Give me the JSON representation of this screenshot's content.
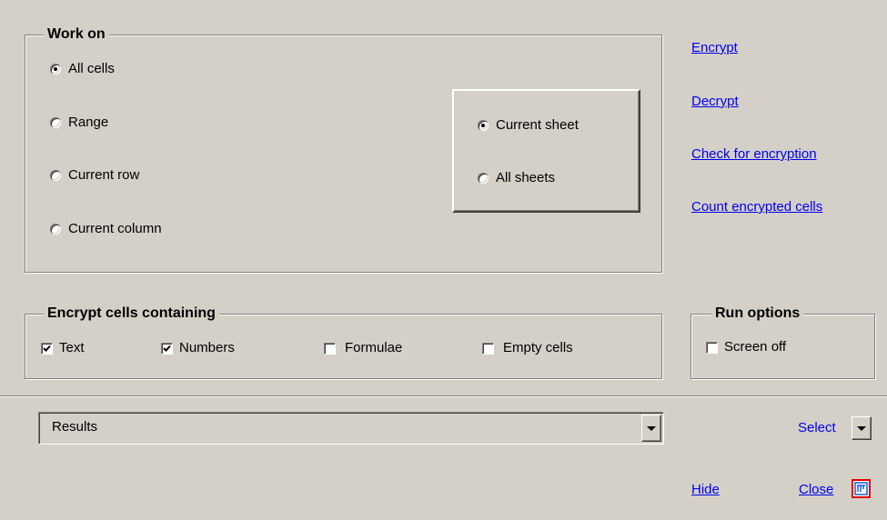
{
  "work_on": {
    "title": "Work on",
    "options": [
      "All cells",
      "Range",
      "Current row",
      "Current column"
    ],
    "selected": "All cells"
  },
  "sheet_scope": {
    "options": [
      "Current sheet",
      "All sheets"
    ],
    "selected": "Current sheet"
  },
  "actions": {
    "encrypt": "Encrypt",
    "decrypt": "Decrypt",
    "check": "Check for encryption",
    "count": "Count encrypted cells"
  },
  "encrypt_containing": {
    "title": "Encrypt cells containing",
    "items": [
      {
        "label": "Text",
        "checked": true
      },
      {
        "label": "Numbers",
        "checked": true
      },
      {
        "label": "Formulae",
        "checked": false
      },
      {
        "label": "Empty cells",
        "checked": false
      }
    ]
  },
  "run_options": {
    "title": "Run options",
    "screen_off": {
      "label": "Screen off",
      "checked": false
    }
  },
  "results": {
    "value": "Results"
  },
  "select_label": "Select",
  "footer": {
    "hide": "Hide",
    "close": "Close"
  },
  "colors": {
    "link": "#0000ee",
    "close_icon_border": "#e00000",
    "close_icon_fill": "#1a5fd0"
  }
}
